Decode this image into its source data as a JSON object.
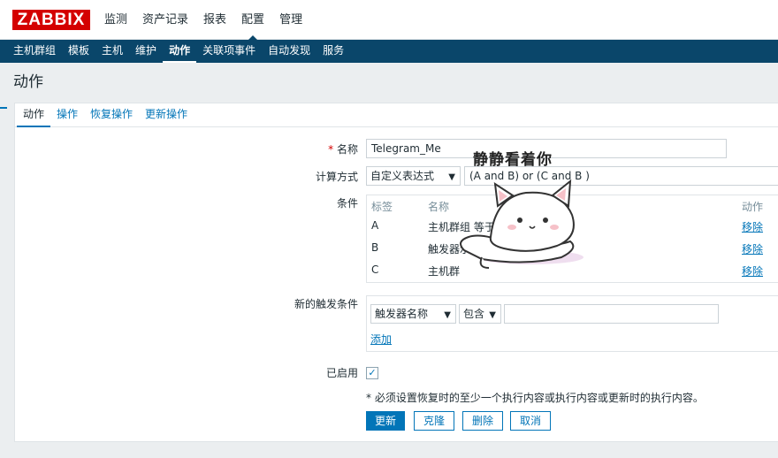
{
  "logo": "ZABBIX",
  "main_menu": [
    "监测",
    "资产记录",
    "报表",
    "配置",
    "管理"
  ],
  "sub_menu": [
    "主机群组",
    "模板",
    "主机",
    "维护",
    "动作",
    "关联项事件",
    "自动发现",
    "服务"
  ],
  "page_title": "动作",
  "tabs": [
    "动作",
    "操作",
    "恢复操作",
    "更新操作"
  ],
  "form": {
    "name_label": "名称",
    "name_value": "Telegram_Me",
    "calc_label": "计算方式",
    "calc_select": "自定义表达式",
    "calc_expression": "(A and B) or (C and B )",
    "conditions_label": "条件",
    "conditions_headers": {
      "label": "标签",
      "name": "名称",
      "action": "动作"
    },
    "conditions": [
      {
        "label": "A",
        "name": "主机群组 等于",
        "action": "移除"
      },
      {
        "label": "B",
        "name": "触发器示",
        "action": "移除"
      },
      {
        "label": "C",
        "name": "主机群",
        "action": "移除"
      }
    ],
    "new_condition_label": "新的触发条件",
    "new_condition_type": "触发器名称",
    "new_condition_operator": "包含",
    "new_condition_value": "",
    "add_link": "添加",
    "enabled_label": "已启用",
    "enabled_check": "✓",
    "required_note": "* 必须设置恢复时的至少一个执行内容或执行内容或更新时的执行内容。",
    "buttons": {
      "update": "更新",
      "clone": "克隆",
      "delete": "删除",
      "cancel": "取消"
    }
  },
  "sticker_text": "静静看着你",
  "icons": {
    "select_arrow": "▼"
  },
  "colors": {
    "brand_red": "#d40000",
    "nav_blue": "#0a466a",
    "link_blue": "#0275b8"
  }
}
